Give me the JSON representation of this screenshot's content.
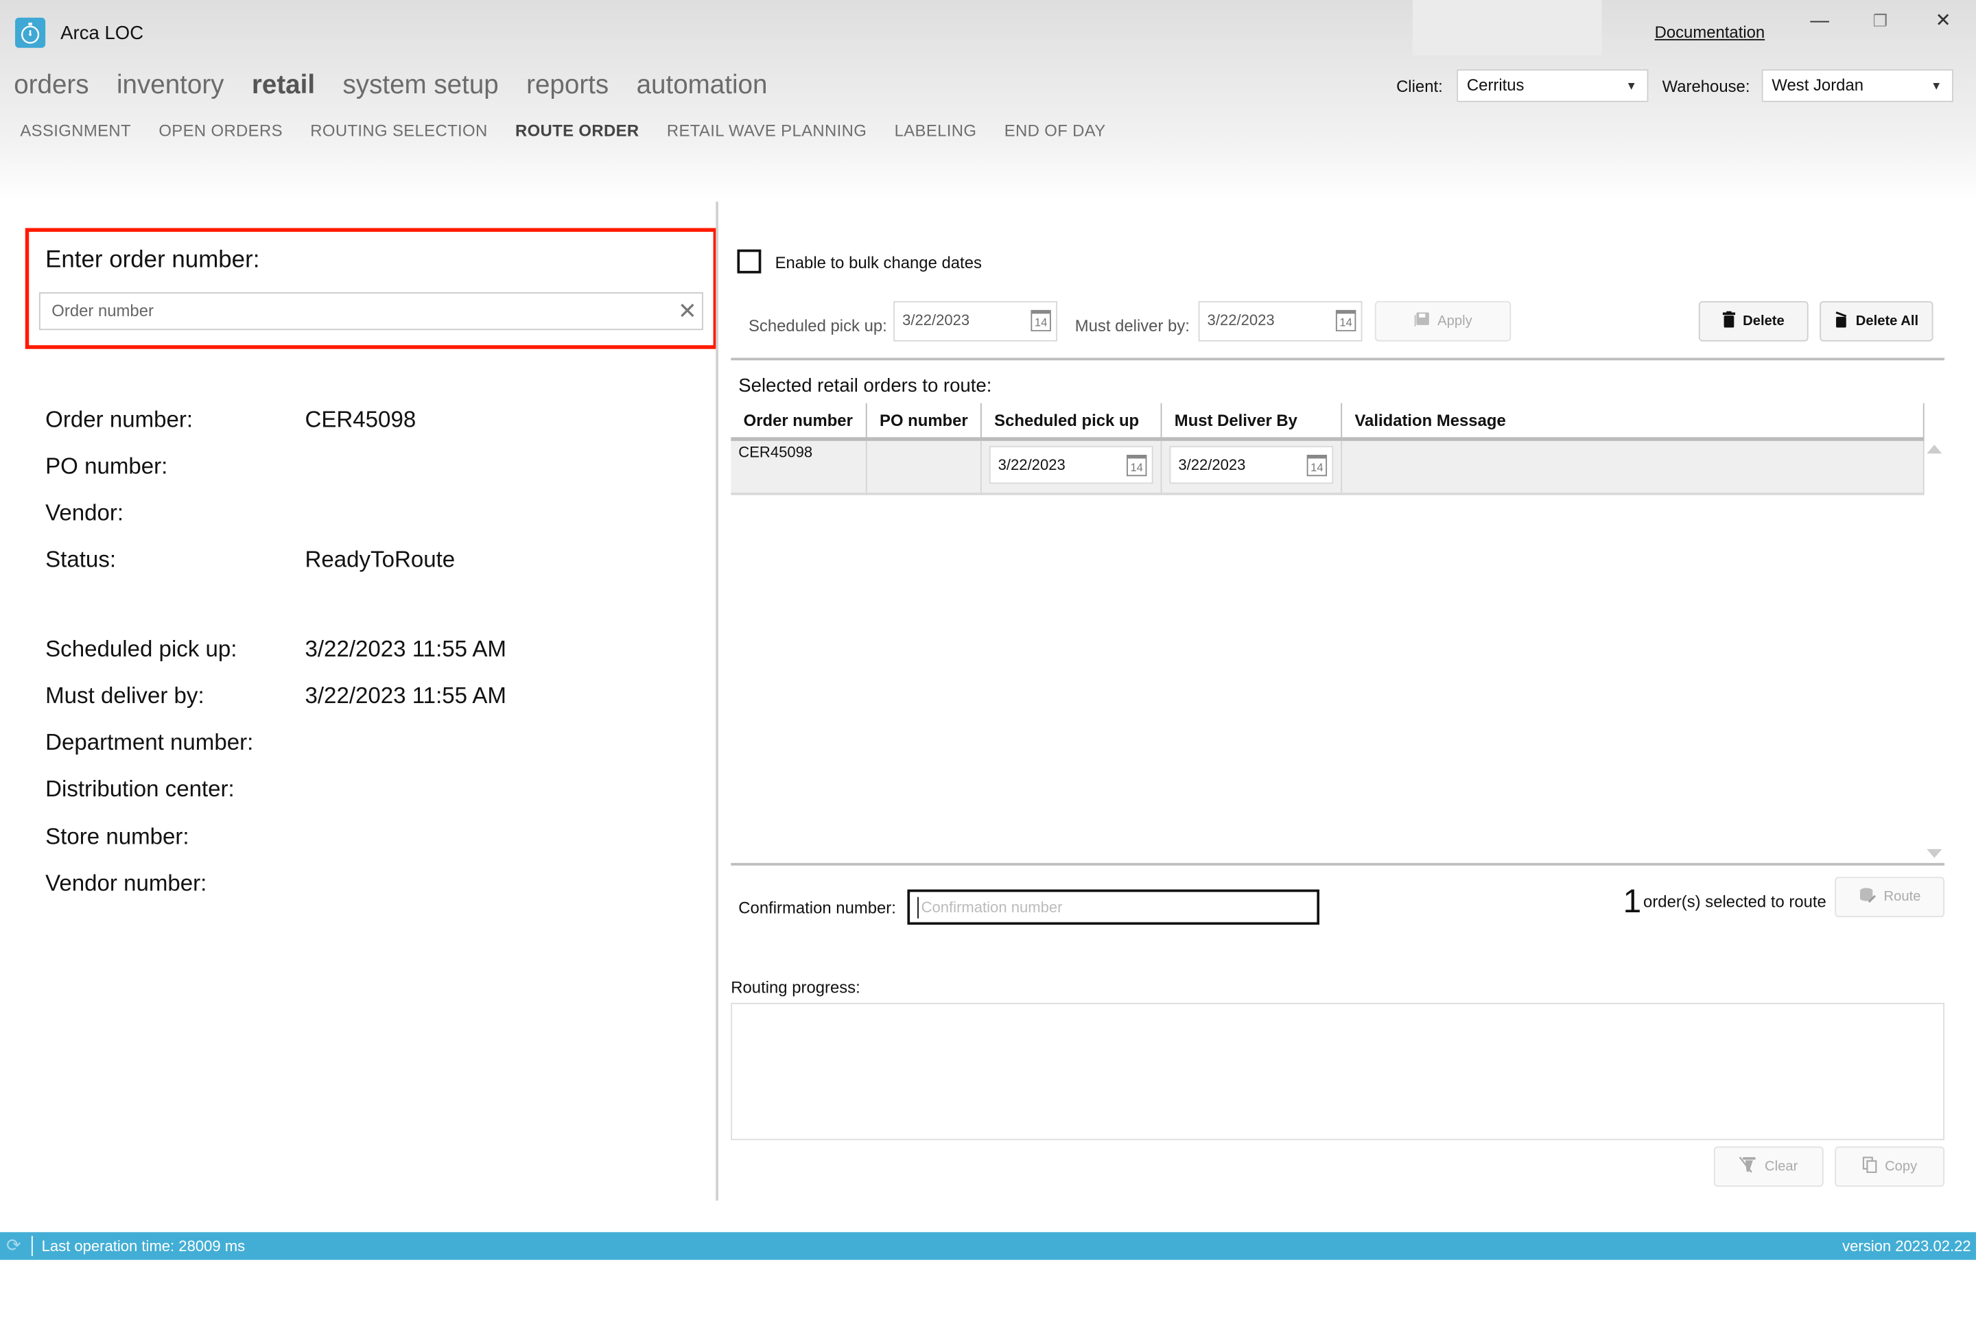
{
  "app": {
    "title": "Arca LOC",
    "documentation_link": "Documentation"
  },
  "window_controls": {
    "minimize": "—",
    "restore": "❐",
    "close": "✕"
  },
  "main_nav": [
    {
      "label": "orders",
      "active": false
    },
    {
      "label": "inventory",
      "active": false
    },
    {
      "label": "retail",
      "active": true
    },
    {
      "label": "system setup",
      "active": false
    },
    {
      "label": "reports",
      "active": false
    },
    {
      "label": "automation",
      "active": false
    }
  ],
  "sub_nav": [
    {
      "label": "ASSIGNMENT",
      "active": false
    },
    {
      "label": "OPEN ORDERS",
      "active": false
    },
    {
      "label": "ROUTING SELECTION",
      "active": false
    },
    {
      "label": "ROUTE ORDER",
      "active": true
    },
    {
      "label": "RETAIL WAVE PLANNING",
      "active": false
    },
    {
      "label": "LABELING",
      "active": false
    },
    {
      "label": "END OF DAY",
      "active": false
    }
  ],
  "filters": {
    "client_label": "Client:",
    "client_value": "Cerritus",
    "warehouse_label": "Warehouse:",
    "warehouse_value": "West Jordan"
  },
  "order_entry": {
    "label": "Enter order number:",
    "placeholder": "Order number",
    "value": ""
  },
  "order_info": {
    "rows_top": [
      {
        "label": "Order number:",
        "value": "CER45098"
      },
      {
        "label": "PO number:",
        "value": ""
      },
      {
        "label": "Vendor:",
        "value": ""
      },
      {
        "label": "Status:",
        "value": "ReadyToRoute"
      }
    ],
    "rows_bottom": [
      {
        "label": "Scheduled pick up:",
        "value": "3/22/2023 11:55 AM"
      },
      {
        "label": "Must deliver by:",
        "value": "3/22/2023 11:55 AM"
      },
      {
        "label": "Department number:",
        "value": ""
      },
      {
        "label": "Distribution center:",
        "value": ""
      },
      {
        "label": "Store number:",
        "value": ""
      },
      {
        "label": "Vendor number:",
        "value": ""
      }
    ]
  },
  "bulk": {
    "checkbox_label": "Enable to bulk change dates",
    "checked": false,
    "pickup_label": "Scheduled pick up:",
    "pickup_value": "3/22/2023",
    "deliver_label": "Must deliver by:",
    "deliver_value": "3/22/2023",
    "calendar_day": "14",
    "apply_label": "Apply",
    "delete_label": "Delete",
    "delete_all_label": "Delete All"
  },
  "grid": {
    "title": "Selected retail orders to route:",
    "columns": [
      "Order number",
      "PO number",
      "Scheduled pick up",
      "Must Deliver By",
      "Validation Message"
    ],
    "rows": [
      {
        "order_number": "CER45098",
        "po_number": "",
        "scheduled_pick_up": "3/22/2023",
        "must_deliver_by": "3/22/2023",
        "validation_message": ""
      }
    ]
  },
  "route": {
    "confirmation_label": "Confirmation number:",
    "confirmation_placeholder": "Confirmation number",
    "selected_count": "1",
    "selected_text": "order(s) selected to route",
    "route_label": "Route",
    "progress_label": "Routing progress:",
    "progress_text": "",
    "clear_label": "Clear",
    "copy_label": "Copy"
  },
  "status_bar": {
    "last_operation": "Last operation time:  28009 ms",
    "version": "version 2023.02.22"
  },
  "colors": {
    "accent": "#43aed5",
    "highlight": "#ff1a00"
  }
}
